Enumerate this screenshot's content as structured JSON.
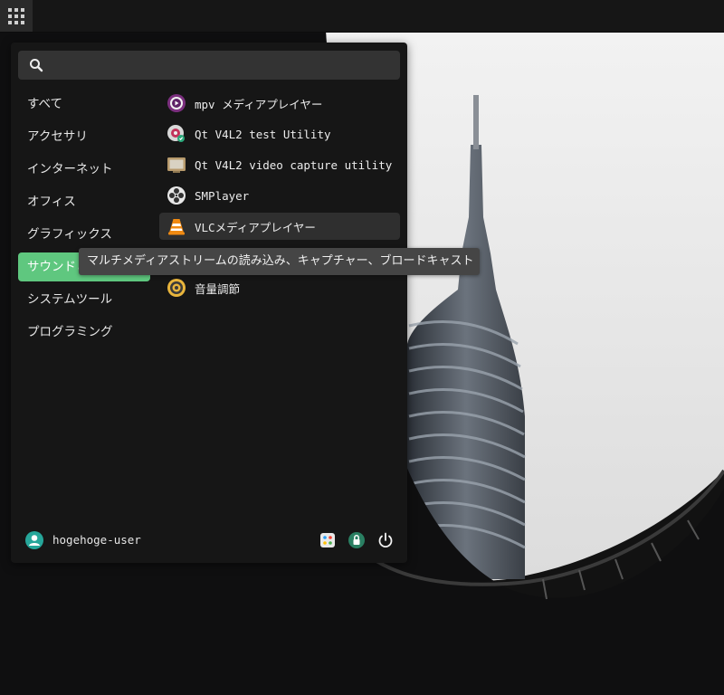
{
  "panel": {
    "apps_button": "apps-grid-icon"
  },
  "search": {
    "value": "",
    "placeholder": "",
    "icon": "search-icon"
  },
  "categories": [
    {
      "label": "すべて"
    },
    {
      "label": "アクセサリ"
    },
    {
      "label": "インターネット"
    },
    {
      "label": "オフィス"
    },
    {
      "label": "グラフィックス"
    },
    {
      "label": "サウンドとビデオ",
      "selected": true
    },
    {
      "label": "システムツール"
    },
    {
      "label": "プログラミング"
    }
  ],
  "apps": [
    {
      "label": "mpv メディアプレイヤー",
      "icon": "mpv-icon"
    },
    {
      "label": "Qt V4L2 test Utility",
      "icon": "qv4l2-icon"
    },
    {
      "label": "Qt V4L2 video capture utility",
      "icon": "tv-icon"
    },
    {
      "label": "SMPlayer",
      "icon": "smplayer-icon"
    },
    {
      "label": "VLCメディアプレイヤー",
      "icon": "vlc-icon",
      "hovered": true
    },
    {
      "label": "",
      "icon": "hidden-by-tooltip"
    },
    {
      "label": "音量調節",
      "icon": "volume-icon"
    }
  ],
  "tooltip": {
    "text": "マルチメディアストリームの読み込み、キャプチャー、ブロードキャスト"
  },
  "footer": {
    "username": "hogehoge-user",
    "buttons": [
      "settings-icon",
      "lock-screen-icon",
      "power-icon"
    ]
  },
  "colors": {
    "accent": "#5fc77f",
    "menu_bg": "#161616",
    "search_bg": "#333333",
    "tooltip_bg": "#454545"
  }
}
